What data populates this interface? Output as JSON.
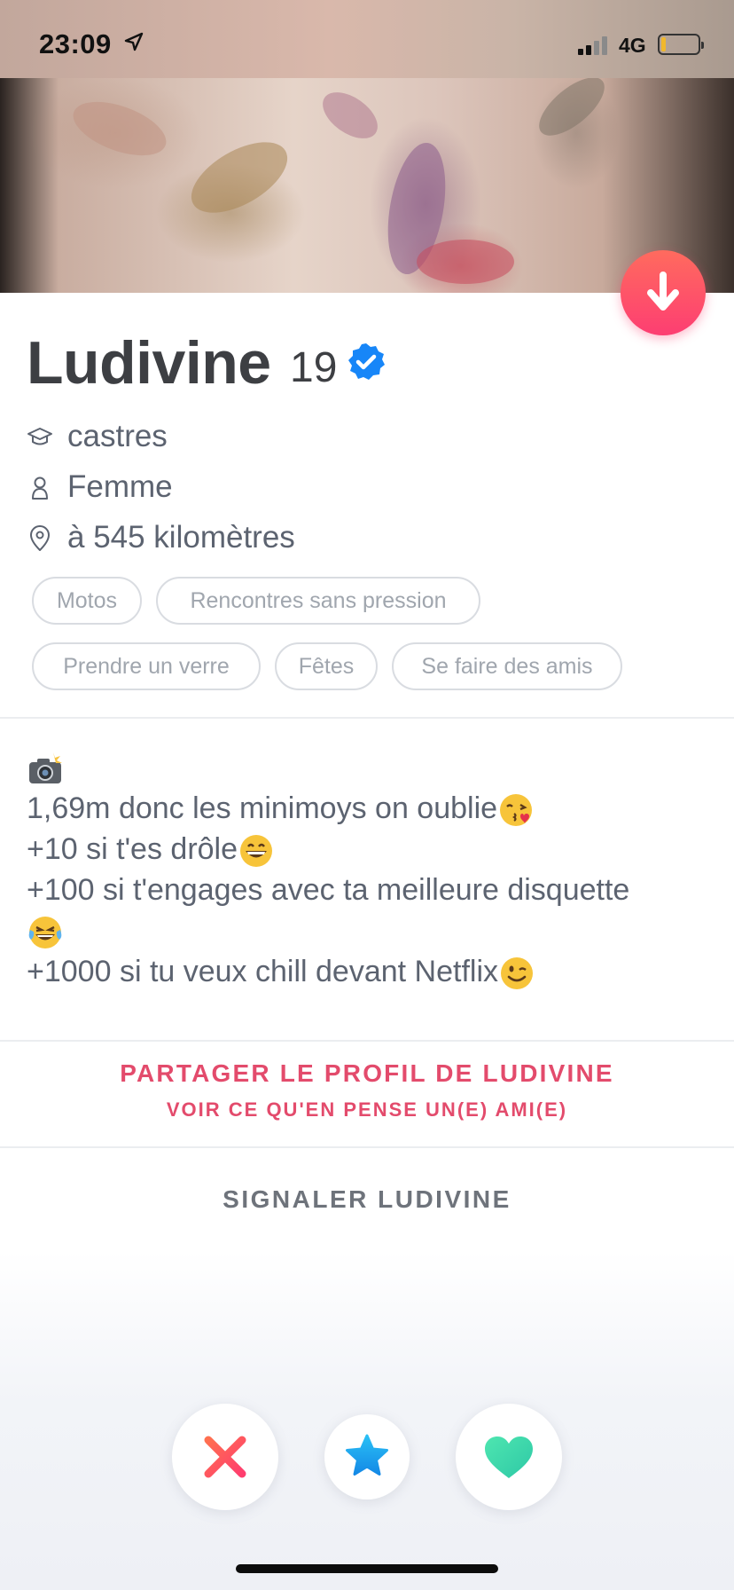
{
  "status_bar": {
    "time": "23:09",
    "network": "4G",
    "battery_color": "#f1b82c"
  },
  "profile": {
    "name": "Ludivine",
    "age": "19",
    "verified": true,
    "school": "castres",
    "gender": "Femme",
    "distance": "à 545 kilomètres"
  },
  "interests": [
    "Motos",
    "Rencontres sans pression",
    "Prendre un verre",
    "Fêtes",
    "Se faire des amis"
  ],
  "bio": {
    "line1": "1,69m donc les minimoys on oublie",
    "line2": "+10 si t'es drôle",
    "line3": "+100 si t'engages avec ta meilleure disquette",
    "line4": "+1000 si tu veux chill devant Netflix",
    "emojis": [
      "camera-with-flash",
      "face-blowing-kiss",
      "grinning-face",
      "face-with-tears-of-joy",
      "winking-face"
    ]
  },
  "share": {
    "title": "PARTAGER LE PROFIL DE LUDIVINE",
    "subtitle": "VOIR CE QU'EN PENSE UN(E) AMI(E)"
  },
  "report": {
    "label": "SIGNALER LUDIVINE"
  },
  "actions": {
    "nope_icon": "x-icon",
    "super_like_icon": "star-icon",
    "like_icon": "heart-icon"
  },
  "colors": {
    "accent": "#fd3e72",
    "share_text": "#e34b6c",
    "verified": "#1786f8",
    "nope": "#ff4b63",
    "super_like": "#1aa5f0",
    "like": "#39d6a8"
  }
}
